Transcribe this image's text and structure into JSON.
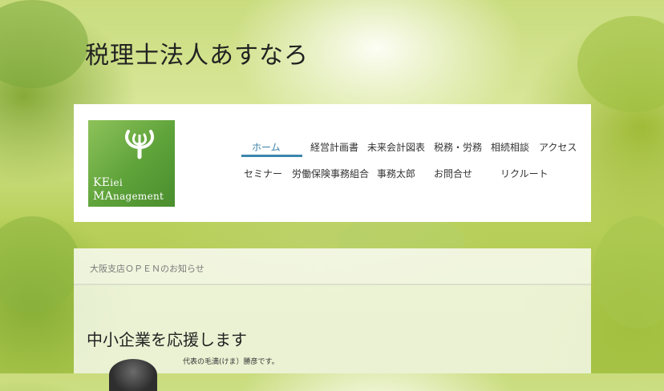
{
  "site": {
    "title": "税理士法人あすなろ"
  },
  "logo": {
    "line1_big": "KE",
    "line1_rest": "iei",
    "line2_big": "MA",
    "line2_rest": "nagement"
  },
  "nav": {
    "row1": [
      "ホーム",
      "経営計画書",
      "未来会計図表",
      "税務・労務",
      "相続相談",
      "アクセス"
    ],
    "row2": [
      "セミナー",
      "労働保険事務組合",
      "事務太郎",
      "お問合せ",
      "リクルート"
    ],
    "active": "ホーム"
  },
  "notice": {
    "text": "大阪支店ＯＰＥＮのお知らせ"
  },
  "main": {
    "heading": "中小企業を応援します",
    "intro": "代表の毛満(けま）勝彦です。"
  },
  "colors": {
    "accent": "#3a86ad",
    "logo_green": "#5ea23a"
  }
}
